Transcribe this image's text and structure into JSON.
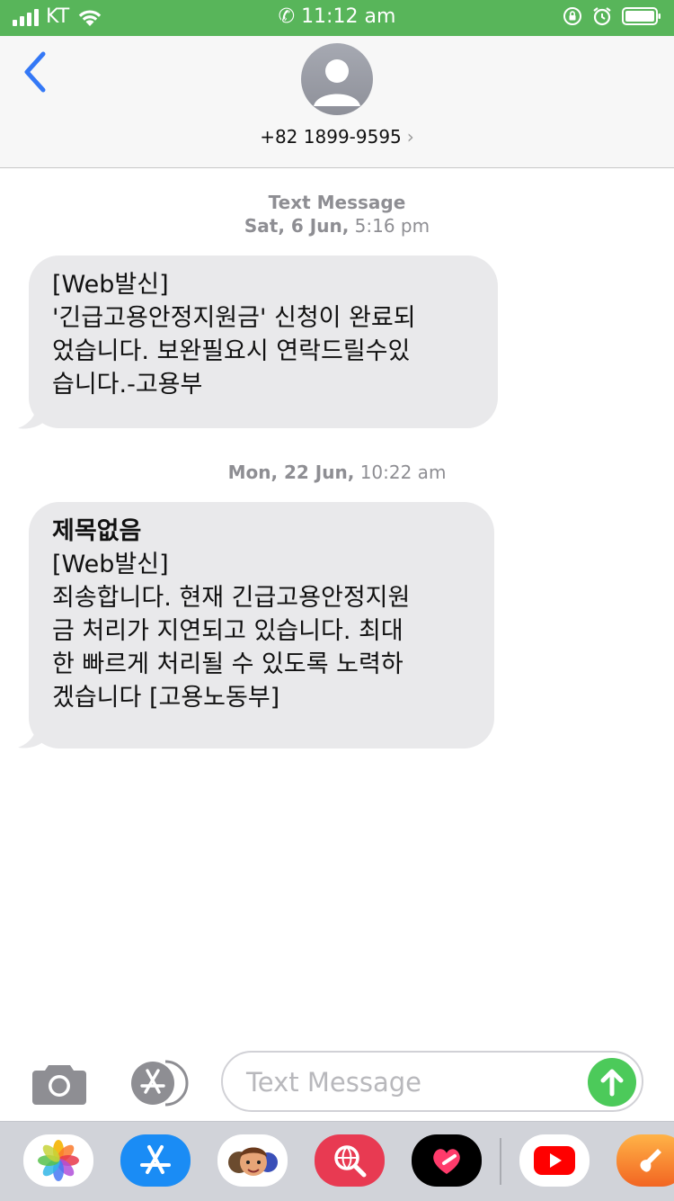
{
  "status_bar": {
    "carrier": "KT",
    "time": "11:12 am",
    "in_call": true,
    "battery_color": "#ffffff",
    "bar_color": "#58b55a"
  },
  "header": {
    "back_icon": "chevron-left-icon",
    "contact": "+82 1899-9595",
    "contact_chevron": "›",
    "accent_color": "#3478f6"
  },
  "thread": {
    "service": "Text Message",
    "date1_day": "Sat, 6 Jun,",
    "date1_time": "5:16 pm",
    "message1": {
      "line1": "[Web발신]",
      "line2": "'긴급고용안정지원금' 신청이 완료되",
      "line3": "었습니다. 보완필요시 연락드릴수있",
      "line4": "습니다.-고용부"
    },
    "date2_day": "Mon, 22 Jun,",
    "date2_time": "10:22 am",
    "message2": {
      "subject": "제목없음",
      "line1": "[Web발신]",
      "line2": "죄송합니다. 현재 긴급고용안정지원",
      "line3": "금 처리가 지연되고 있습니다. 최대",
      "line4": "한 빠르게 처리될 수 있도록 노력하",
      "line5": "겠습니다 [고용노동부]"
    }
  },
  "composer": {
    "placeholder": "Text Message",
    "send_color": "#4cca5a"
  },
  "app_drawer": {
    "apps": [
      "photos-icon",
      "app-store-icon",
      "memoji-icon",
      "web-search-icon",
      "digital-touch-icon",
      "youtube-icon",
      "garageband-icon"
    ]
  }
}
